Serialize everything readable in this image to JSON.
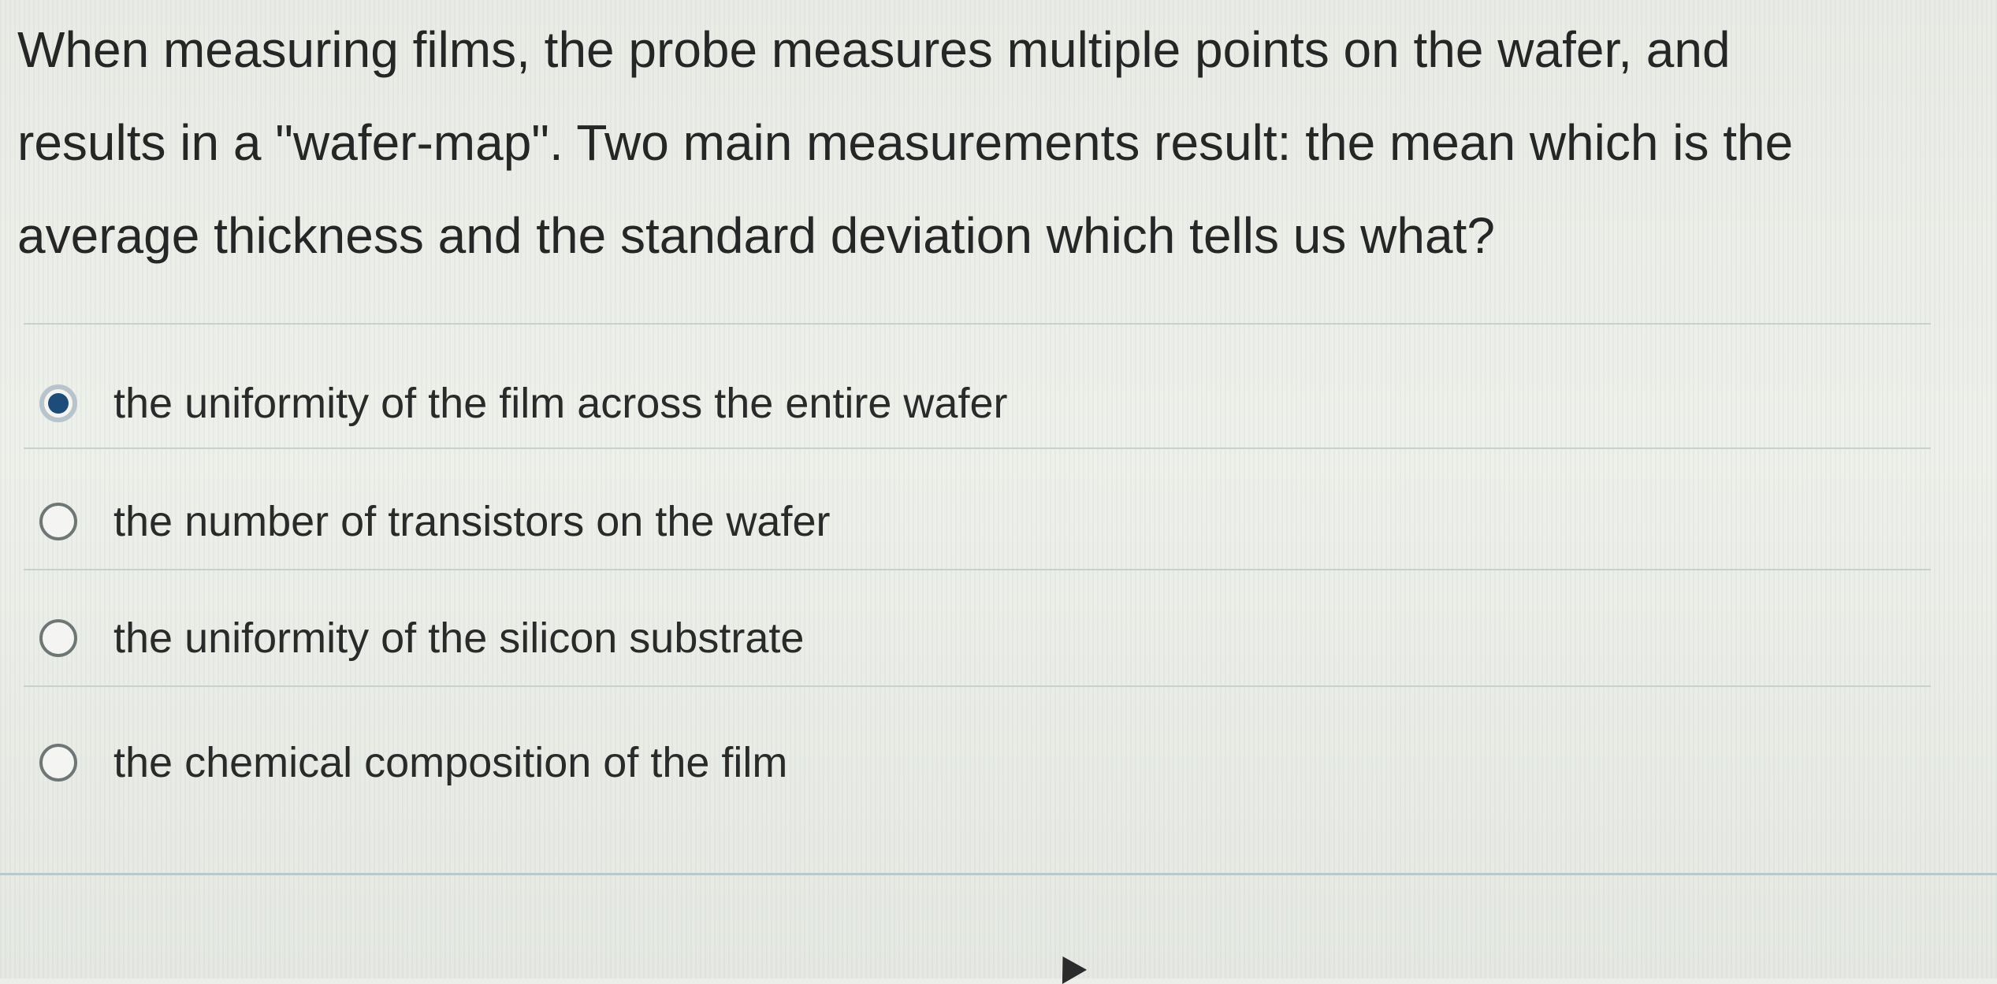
{
  "question": {
    "line1": "When measuring films, the probe measures multiple points on the wafer, and",
    "line2": "results in a \"wafer-map\". Two main measurements result: the mean which is the",
    "line3": "average thickness and the standard deviation which tells us what?"
  },
  "options": [
    {
      "label": "the uniformity of the film across the entire wafer",
      "selected": true
    },
    {
      "label": "the number of transistors on the wafer",
      "selected": false
    },
    {
      "label": "the uniformity of the silicon substrate",
      "selected": false
    },
    {
      "label": "the chemical composition of the film",
      "selected": false
    }
  ],
  "colors": {
    "selected_radio": "#1e4c7a",
    "background": "#eceee9",
    "text": "#262626"
  },
  "icons": {
    "cursor": "mouse-pointer-icon"
  }
}
